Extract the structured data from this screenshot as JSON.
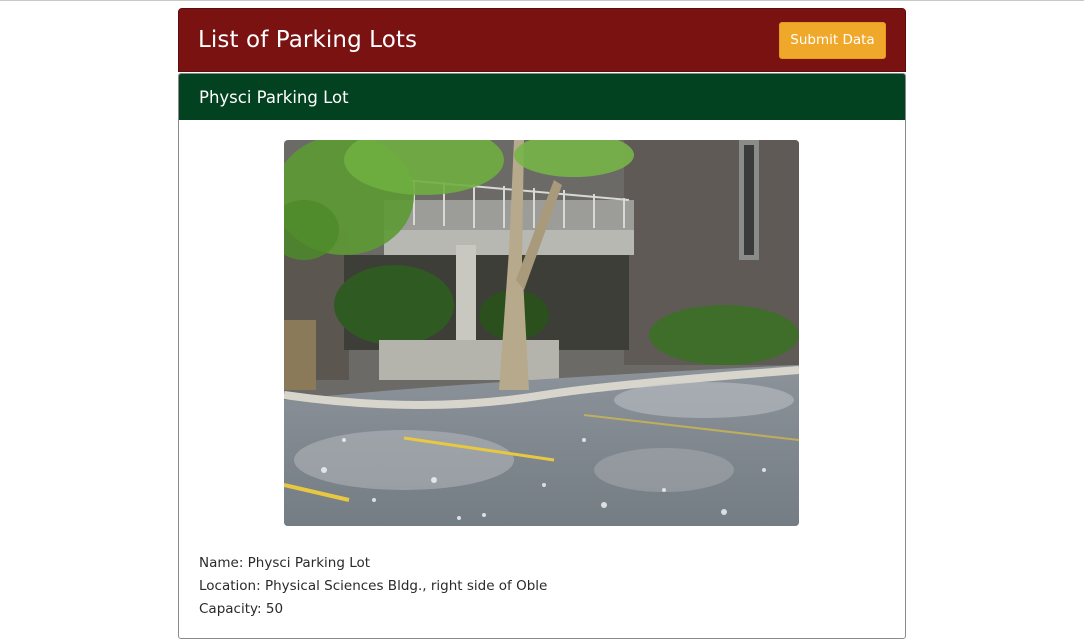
{
  "header": {
    "title": "List of Parking Lots",
    "submit_label": "Submit Data"
  },
  "lot": {
    "card_title": "Physci Parking Lot",
    "name_line": "Name: Physci Parking Lot",
    "location_line": "Location: Physical Sciences Bldg., right side of Oble",
    "capacity_line": "Capacity: 50"
  },
  "colors": {
    "header_bg": "#7a1212",
    "button_bg": "#f0a82a",
    "card_header_bg": "#034220"
  }
}
